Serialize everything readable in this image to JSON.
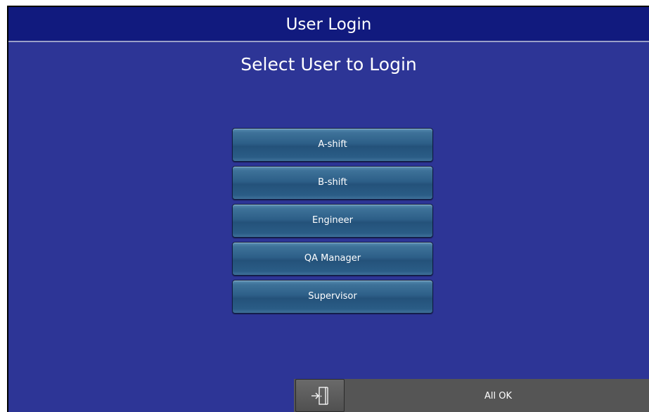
{
  "window": {
    "title": "User Login"
  },
  "main": {
    "heading": "Select User to Login"
  },
  "users": [
    {
      "label": "A-shift"
    },
    {
      "label": "B-shift"
    },
    {
      "label": "Engineer"
    },
    {
      "label": "QA Manager"
    },
    {
      "label": "Supervisor"
    }
  ],
  "footer": {
    "logout_icon": "logout-door-icon",
    "status": "All OK"
  },
  "colors": {
    "background": "#2d3596",
    "title_bar": "#111a7e",
    "button": "#2d5f88",
    "footer": "#555555"
  }
}
